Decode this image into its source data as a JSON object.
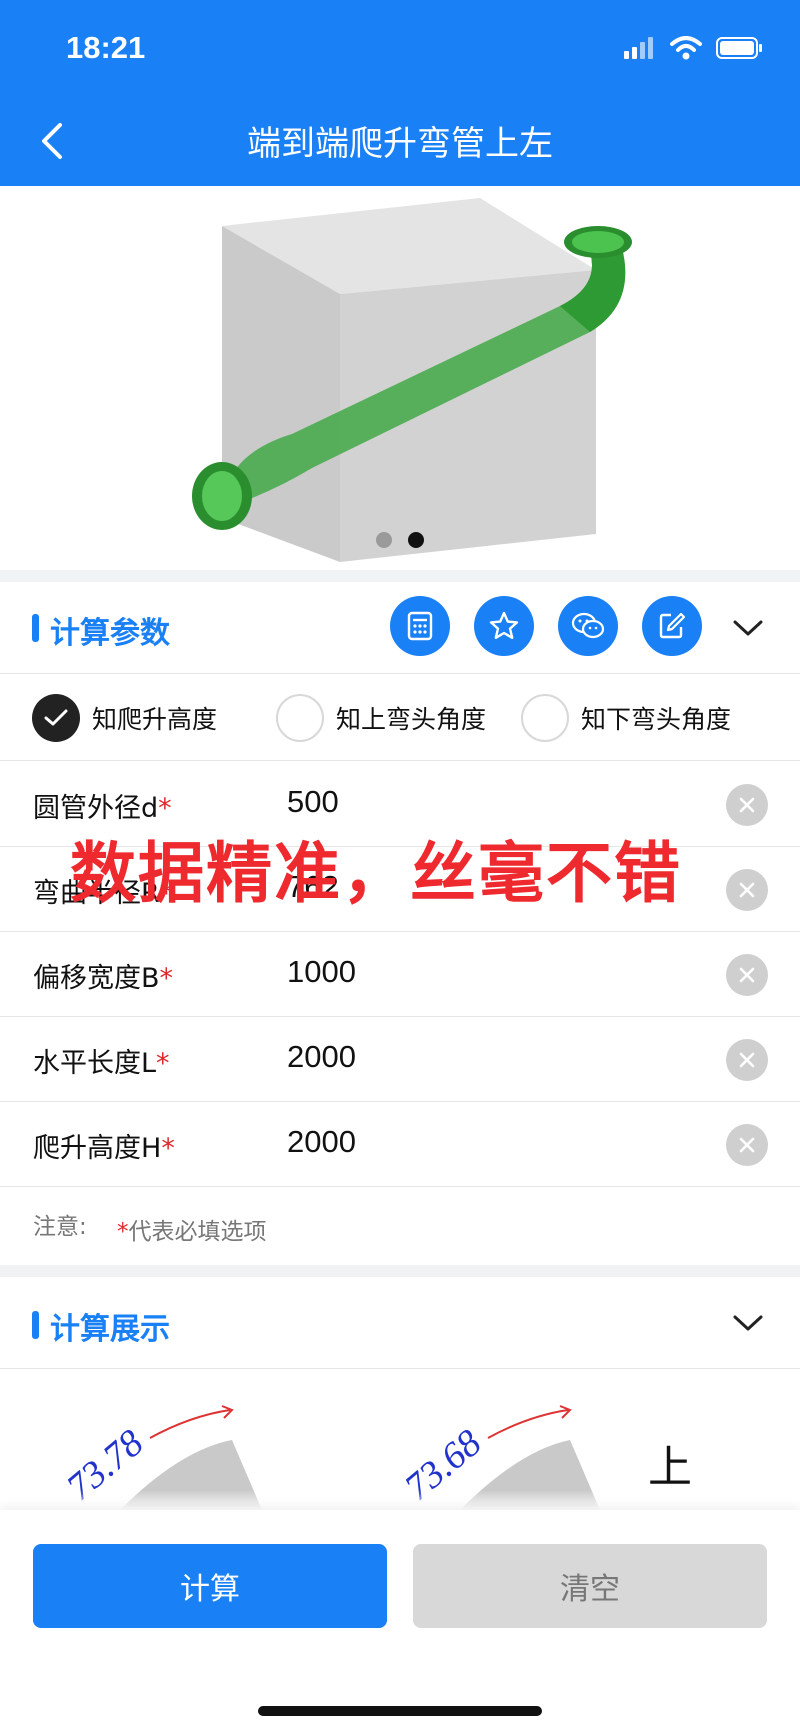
{
  "status": {
    "time": "18:21"
  },
  "nav": {
    "title": "端到端爬升弯管上左"
  },
  "section_params": {
    "title": "计算参数"
  },
  "modes": [
    {
      "label": "知爬升高度",
      "checked": true
    },
    {
      "label": "知上弯头角度",
      "checked": false
    },
    {
      "label": "知下弯头角度",
      "checked": false
    }
  ],
  "fields": [
    {
      "label": "圆管外径d",
      "req": "*",
      "value": "500"
    },
    {
      "label": "弯曲半径R",
      "req": "*",
      "value": "762"
    },
    {
      "label": "偏移宽度B",
      "req": "*",
      "value": "1000"
    },
    {
      "label": "水平长度L",
      "req": "*",
      "value": "2000"
    },
    {
      "label": "爬升高度H",
      "req": "*",
      "value": "2000"
    }
  ],
  "note": {
    "label": "注意:",
    "req": "*",
    "text": "代表必填选项"
  },
  "overlay": {
    "text": "数据精准，丝毫不错"
  },
  "section_display": {
    "title": "计算展示"
  },
  "preview": {
    "left_value": "73.78",
    "right_value": "73.68",
    "right_char": "上"
  },
  "buttons": {
    "calc": "计算",
    "clear": "清空"
  },
  "colors": {
    "primary": "#1a80f6",
    "required": "#e0272b",
    "overlay": "#ee2a2f",
    "pipe": "#34b53a"
  },
  "carousel": {
    "count": 2,
    "active": 2
  }
}
